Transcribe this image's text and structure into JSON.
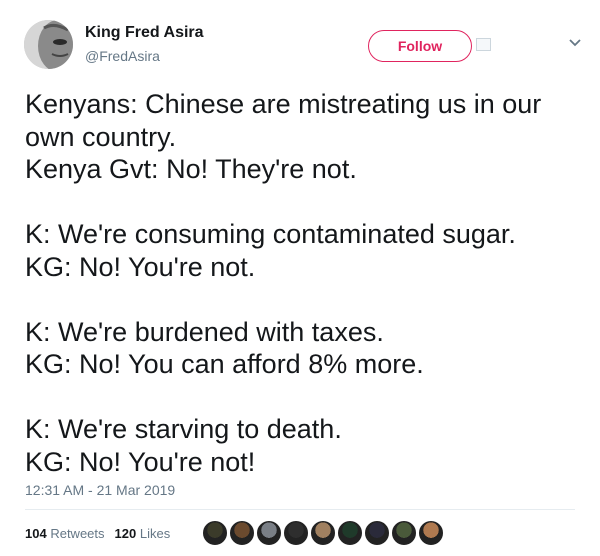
{
  "user": {
    "name": "King Fred Asira",
    "handle": "@FredAsira",
    "avatar": "profile-photo"
  },
  "header": {
    "follow_label": "Follow",
    "accent_color": "#e0245e",
    "menu_icon": "chevron-down-icon",
    "broken_image_icon": "image-placeholder-icon"
  },
  "tweet": {
    "lines": [
      "Kenyans: Chinese are mistreating us in our",
      "own country.",
      "Kenya Gvt: No! They're not.",
      "",
      "K: We're consuming contaminated sugar.",
      "KG: No! You're not.",
      "",
      "K: We're burdened with taxes.",
      "KG: No! You can afford 8% more.",
      "",
      "K: We're starving to death.",
      "KG: No! You're not!"
    ],
    "timestamp": "12:31 AM - 21 Mar 2019"
  },
  "stats": {
    "retweets_count": "104",
    "retweets_label": "Retweets",
    "likes_count": "120",
    "likes_label": "Likes"
  },
  "likers": {
    "colors": [
      "#3b3b2a",
      "#6b4a2e",
      "#7a7f86",
      "#2e2e2e",
      "#a08060",
      "#1f3a2a",
      "#2a2a3a",
      "#4a5a3a",
      "#b07a50"
    ]
  }
}
